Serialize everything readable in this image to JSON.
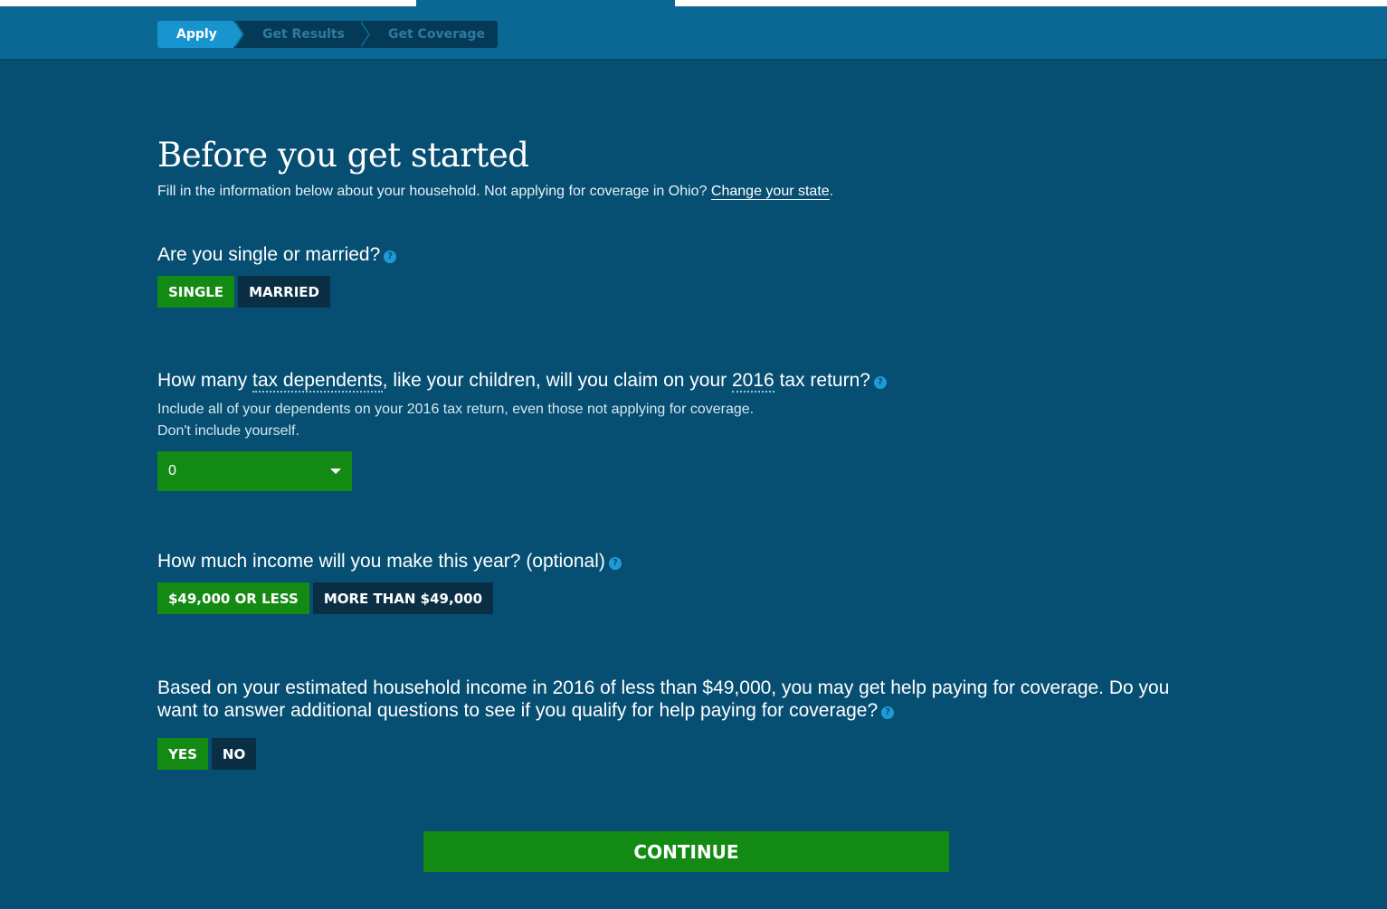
{
  "progress": {
    "steps": [
      {
        "label": "Apply",
        "state": "active"
      },
      {
        "label": "Get Results",
        "state": "inactive"
      },
      {
        "label": "Get Coverage",
        "state": "inactive"
      }
    ]
  },
  "page": {
    "title": "Before you get started",
    "intro_text": "Fill in the information below about your household. Not applying for coverage in Ohio?",
    "intro_link": "Change your state",
    "intro_end": "."
  },
  "marital": {
    "question": "Are you single or married?",
    "options": [
      {
        "label": "SINGLE",
        "selected": true
      },
      {
        "label": "MARRIED",
        "selected": false
      }
    ]
  },
  "dependents": {
    "q_part1": "How many",
    "q_term1": "tax dependents",
    "q_part2": ", like your children, will you claim on your",
    "q_term2": "2016",
    "q_part3": "tax return?",
    "hint_line1": "Include all of your dependents on your 2016 tax return, even those not applying for coverage.",
    "hint_line2": "Don't include yourself.",
    "selected_value": "0"
  },
  "income": {
    "question": "How much income will you make this year? (optional)",
    "options": [
      {
        "label": "$49,000 OR LESS",
        "selected": true
      },
      {
        "label": "MORE THAN $49,000",
        "selected": false
      }
    ]
  },
  "assistance": {
    "question_line1": "Based on your estimated household income in 2016 of less than $49,000, you may get help paying for coverage. Do you",
    "question_line2": "want to answer additional questions to see if you qualify for help paying for coverage?",
    "options": [
      {
        "label": "YES",
        "selected": true
      },
      {
        "label": "NO",
        "selected": false
      }
    ]
  },
  "actions": {
    "continue_label": "CONTINUE"
  },
  "icons": {
    "help": "help-icon",
    "dropdown": "chevron-down-icon"
  },
  "colors": {
    "background": "#064f73",
    "header": "#0b6894",
    "selected": "#138a14",
    "unselected": "#0a2f45",
    "active_step": "#1895cf"
  }
}
